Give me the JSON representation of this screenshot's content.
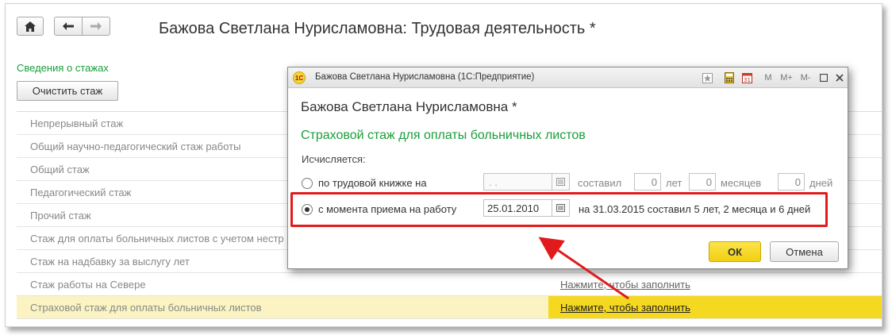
{
  "window": {
    "title": "Бажова Светлана Нурисламовна: Трудовая деятельность *"
  },
  "nav": {
    "home_icon": "home-icon",
    "back_icon": "arrow-left-icon",
    "forward_icon": "arrow-right-icon"
  },
  "section": {
    "link": "Сведения о стажах",
    "clear_button": "Очистить стаж"
  },
  "table": {
    "rows": [
      {
        "label": "Непрерывный стаж",
        "value": ""
      },
      {
        "label": "Общий научно-педагогический стаж работы",
        "value": ""
      },
      {
        "label": "Общий стаж",
        "value": ""
      },
      {
        "label": "Педагогический стаж",
        "value": ""
      },
      {
        "label": "Прочий стаж",
        "value": ""
      },
      {
        "label": "Стаж для оплаты больничных листов с учетом нестр",
        "value": ""
      },
      {
        "label": "Стаж на надбавку за выслугу лет",
        "value": ""
      },
      {
        "label": "Стаж работы на Севере",
        "value": "Нажмите, чтобы заполнить"
      },
      {
        "label": "Страховой стаж для оплаты больничных листов",
        "value": "Нажмите, чтобы заполнить"
      }
    ]
  },
  "dialog": {
    "caption": "Бажова Светлана Нурисламовна  (1С:Предприятие)",
    "logo": "1С",
    "toolbar": {
      "m": "M",
      "m_plus": "M+",
      "m_minus": "M-"
    },
    "heading": "Бажова Светлана Нурисламовна *",
    "subheading": "Страховой стаж для оплаты больничных листов",
    "calc_label": "Исчисляется:",
    "option1": {
      "label": "по трудовой книжке на",
      "date_placeholder": " .  .",
      "made": "составил",
      "years": "0",
      "years_unit": "лет",
      "months": "0",
      "months_unit": "месяцев",
      "days": "0",
      "days_unit": "дней"
    },
    "option2": {
      "label": "с момента приема на работу",
      "date": "25.01.2010",
      "result": "на 31.03.2015 составил 5 лет, 2 месяца и 6 дней"
    },
    "ok_button": "ОК",
    "cancel_button": "Отмена"
  },
  "colors": {
    "accent_green": "#1a9e3c",
    "highlight_red": "#e11b1b",
    "ok_yellow": "#f5d820",
    "selected_row": "#fbf3c2"
  }
}
